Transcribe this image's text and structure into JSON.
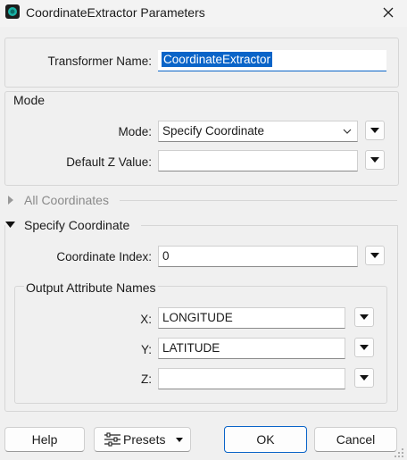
{
  "window": {
    "title": "CoordinateExtractor Parameters",
    "accent": "#0a64c8"
  },
  "transformer": {
    "label": "Transformer Name:",
    "value": "CoordinateExtractor"
  },
  "mode_group": {
    "title": "Mode",
    "mode_label": "Mode:",
    "mode_value": "Specify Coordinate",
    "default_z_label": "Default Z Value:",
    "default_z_value": ""
  },
  "all_coordinates": {
    "title": "All Coordinates"
  },
  "specify_coordinate": {
    "title": "Specify Coordinate",
    "index_label": "Coordinate Index:",
    "index_value": "0",
    "output_group": {
      "title": "Output Attribute Names",
      "x_label": "X:",
      "x_value": "LONGITUDE",
      "y_label": "Y:",
      "y_value": "LATITUDE",
      "z_label": "Z:",
      "z_value": ""
    }
  },
  "footer": {
    "help_label": "Help",
    "presets_label": "Presets",
    "ok_label": "OK",
    "cancel_label": "Cancel"
  }
}
